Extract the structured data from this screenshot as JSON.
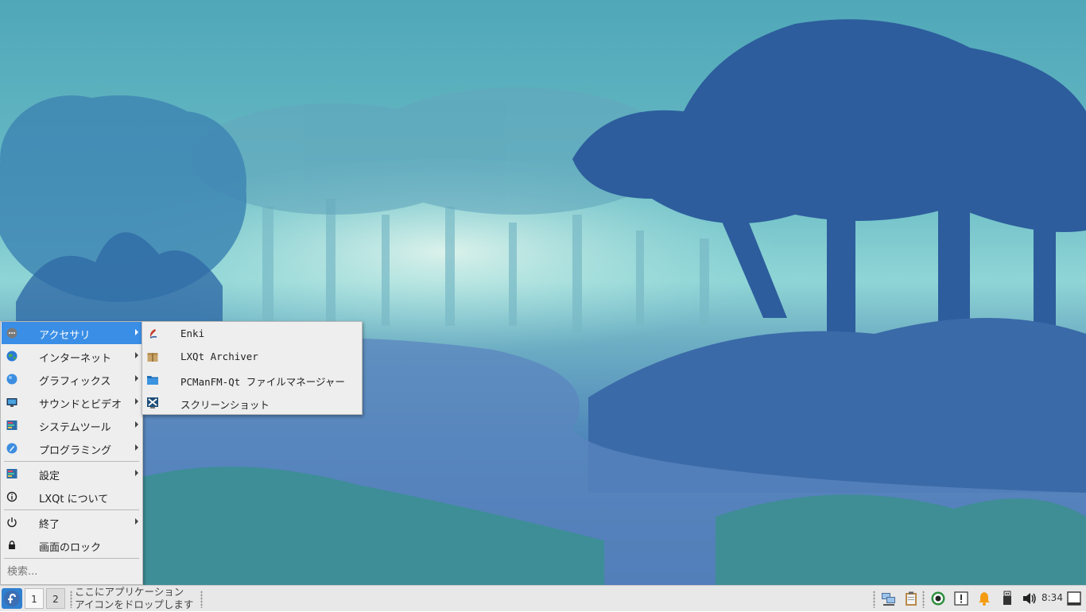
{
  "main_menu": {
    "items": [
      {
        "label": "アクセサリ",
        "icon": "accessories-icon",
        "submenu": true,
        "active": true
      },
      {
        "label": "インターネット",
        "icon": "internet-globe-icon",
        "submenu": true
      },
      {
        "label": "グラフィックス",
        "icon": "graphics-icon",
        "submenu": true
      },
      {
        "label": "サウンドとビデオ",
        "icon": "multimedia-icon",
        "submenu": true
      },
      {
        "label": "システムツール",
        "icon": "system-tools-icon",
        "submenu": true
      },
      {
        "label": "プログラミング",
        "icon": "programming-icon",
        "submenu": true
      },
      {
        "label": "設定",
        "icon": "settings-icon",
        "submenu": true
      },
      {
        "label": "LXQt について",
        "icon": "info-icon",
        "submenu": false
      },
      {
        "label": "終了",
        "icon": "power-icon",
        "submenu": true
      },
      {
        "label": "画面のロック",
        "icon": "lock-icon",
        "submenu": false
      }
    ],
    "search_placeholder": "検索..."
  },
  "submenu": {
    "parent": "アクセサリ",
    "items": [
      {
        "label": "Enki",
        "icon": "enki-editor-icon"
      },
      {
        "label": "LXQt Archiver",
        "icon": "archiver-box-icon"
      },
      {
        "label": "PCManFM-Qt ファイルマネージャー",
        "icon": "folder-icon"
      },
      {
        "label": "スクリーンショット",
        "icon": "screenshot-icon"
      }
    ]
  },
  "taskbar": {
    "desktops": [
      "1",
      "2"
    ],
    "quicklaunch_hint_line1": "ここにアプリケーション",
    "quicklaunch_hint_line2": "アイコンをドロップします",
    "clock": "8:34",
    "tray_icons": [
      "network-icon",
      "clipboard-icon",
      "update-ring-icon",
      "alert-icon",
      "notification-bell-icon",
      "usb-drive-icon",
      "volume-icon",
      "show-desktop-icon"
    ]
  },
  "colors": {
    "menu_highlight": "#3a8ee6",
    "menu_background": "#eeeeee",
    "taskbar_background": "#e8e8e8"
  }
}
